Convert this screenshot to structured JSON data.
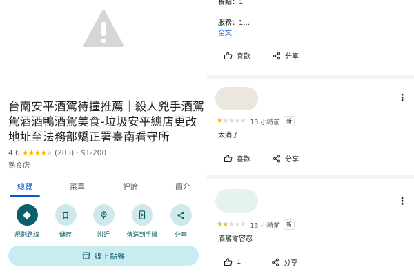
{
  "place": {
    "title": "台南安平酒駕待撞推薦｜殺人兇手酒駕駕酒酒鴨酒駕美食-垃圾安平總店更改地址至法務部矯正署臺南看守所",
    "rating": "4.6",
    "review_count": "(283)",
    "price": "· $1-200",
    "category": "熟食店",
    "stars_filled": 4.5
  },
  "tabs": [
    {
      "label": "總覽",
      "active": true
    },
    {
      "label": "菜單",
      "active": false
    },
    {
      "label": "評論",
      "active": false
    },
    {
      "label": "簡介",
      "active": false
    }
  ],
  "actions": [
    {
      "label": "規劃路線",
      "icon": "directions-icon"
    },
    {
      "label": "儲存",
      "icon": "bookmark-icon"
    },
    {
      "label": "附近",
      "icon": "nearby-icon"
    },
    {
      "label": "傳送到手機",
      "icon": "send-to-phone-icon"
    },
    {
      "label": "分享",
      "icon": "share-icon"
    }
  ],
  "order_button": {
    "label": "線上點餐",
    "icon": "store-icon"
  },
  "top_review": {
    "meal_line": "餐點：1",
    "service_line": "服務：1...",
    "full_text_link": "全文",
    "like_label": "喜歡",
    "share_label": "分享"
  },
  "reviews": [
    {
      "stars": 1,
      "time": "13 小時前",
      "badge": "新",
      "text": "太酒了",
      "like_label": "喜歡",
      "share_label": "分享"
    },
    {
      "stars": 2,
      "time": "13 小時前",
      "badge": "新",
      "text": "酒駕零容忍",
      "like_label": "1",
      "share_label": "分享"
    }
  ],
  "colors": {
    "accent": "#0b57d0",
    "teal": "#0b5f6b",
    "star": "#f6b400",
    "chip": "#c9ecf1"
  }
}
